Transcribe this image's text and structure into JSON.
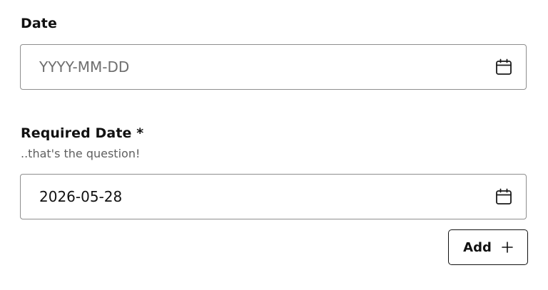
{
  "fields": {
    "date": {
      "label": "Date",
      "placeholder": "YYYY-MM-DD",
      "value": ""
    },
    "required_date": {
      "label": "Required Date *",
      "hint": "..that's the question!",
      "value": "2026-05-28"
    }
  },
  "icons": {
    "calendar": "calendar-icon",
    "plus": "plus-icon"
  },
  "buttons": {
    "add_label": "Add"
  },
  "colors": {
    "border": "#8e8e8e",
    "text": "#111111",
    "hint": "#5f5f5f",
    "placeholder": "#6e6e6e"
  }
}
